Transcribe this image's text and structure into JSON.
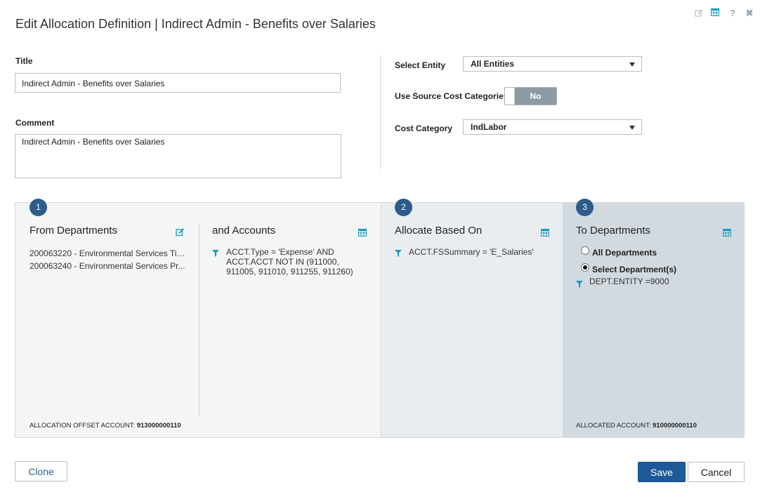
{
  "dialog": {
    "title": "Edit Allocation Definition | Indirect Admin - Benefits over Salaries"
  },
  "top_icons": {
    "edit": "edit-icon",
    "grid": "grid-icon",
    "help": "?",
    "close": "✖"
  },
  "form": {
    "title_label": "Title",
    "title_value": "Indirect Admin - Benefits over Salaries",
    "comment_label": "Comment",
    "comment_value": "Indirect Admin - Benefits over Salaries",
    "entity_label": "Select Entity",
    "entity_value": "All Entities",
    "source_cost_label": "Use Source Cost Categories",
    "source_cost_toggle": "No",
    "cost_category_label": "Cost Category",
    "cost_category_value": "IndLabor"
  },
  "panels": {
    "from": {
      "step": "1",
      "title": "From Departments",
      "items": [
        "200063220 - Environmental Services Tig...",
        "200063240 - Environmental Services Pr..."
      ],
      "offset_label": "ALLOCATION OFFSET ACCOUNT:",
      "offset_value": "913000000110"
    },
    "accounts": {
      "title": "and Accounts",
      "filter_lines": [
        "ACCT.Type = 'Expense' AND",
        "ACCT.ACCT NOT IN (911000,",
        "911005, 911010, 911255, 911260)"
      ]
    },
    "basis": {
      "step": "2",
      "title": "Allocate Based On",
      "filter": "ACCT.FSSummary = 'E_Salaries'"
    },
    "to": {
      "step": "3",
      "title": "To Departments",
      "option_all": "All Departments",
      "option_select": "Select Department(s)",
      "filter": "DEPT.ENTITY =9000",
      "allocated_label": "ALLOCATED ACCOUNT:",
      "allocated_value": "910000000110"
    }
  },
  "buttons": {
    "clone": "Clone",
    "save": "Save",
    "cancel": "Cancel"
  },
  "colors": {
    "accent": "#1f5a98",
    "step_circle": "#2d5c8a",
    "icon_teal": "#1a9bbd"
  }
}
